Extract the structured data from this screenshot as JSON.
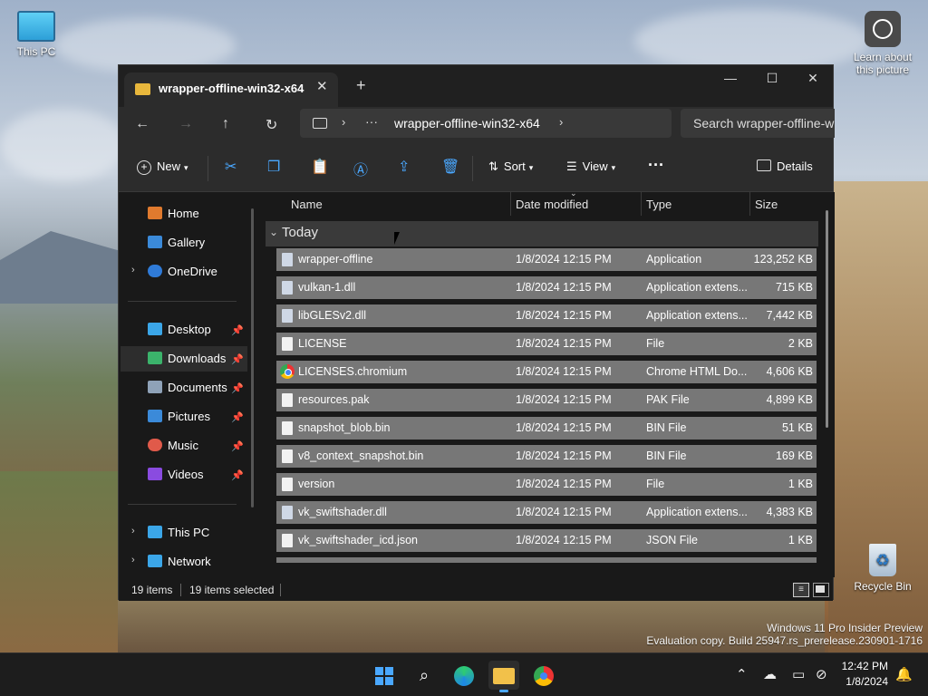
{
  "desktop": {
    "this_pc_label": "This PC",
    "learn_label": "Learn about this picture",
    "recycle_label": "Recycle Bin",
    "watermark_line1": "Windows 11 Pro Insider Preview",
    "watermark_line2": "Evaluation copy. Build 25947.rs_prerelease.230901-1716"
  },
  "window": {
    "tab_title": "wrapper-offline-win32-x64",
    "tab_close": "✕",
    "tab_add": "+",
    "minimize": "—",
    "maximize": "☐",
    "close": "✕",
    "address_ellipsis": "···",
    "address_path": "wrapper-offline-win32-x64",
    "search_placeholder": "Search wrapper-offline-w"
  },
  "toolbar": {
    "new_label": "New",
    "sort_label": "Sort",
    "view_label": "View",
    "more_label": "···",
    "details_label": "Details"
  },
  "sidebar": {
    "items": [
      {
        "label": "Home",
        "icon": "home-icon",
        "color": "#e07a2e"
      },
      {
        "label": "Gallery",
        "icon": "gallery-icon",
        "color": "#3b8ad9"
      },
      {
        "label": "OneDrive",
        "icon": "onedrive-icon",
        "color": "#2f7bd8"
      },
      {
        "label": "Desktop",
        "icon": "desktop-icon",
        "color": "#3ba6e8"
      },
      {
        "label": "Downloads",
        "icon": "downloads-icon",
        "color": "#3bb36b"
      },
      {
        "label": "Documents",
        "icon": "documents-icon",
        "color": "#8fa2b8"
      },
      {
        "label": "Pictures",
        "icon": "pictures-icon",
        "color": "#3b8ad9"
      },
      {
        "label": "Music",
        "icon": "music-icon",
        "color": "#e05a4a"
      },
      {
        "label": "Videos",
        "icon": "videos-icon",
        "color": "#8a4be0"
      },
      {
        "label": "This PC",
        "icon": "this-pc-icon",
        "color": "#3ba6e8"
      },
      {
        "label": "Network",
        "icon": "network-icon",
        "color": "#3ba6e8"
      }
    ]
  },
  "columns": {
    "name": "Name",
    "date": "Date modified",
    "type": "Type",
    "size": "Size"
  },
  "group_label": "Today",
  "files": [
    {
      "name": "wrapper-offline",
      "date": "1/8/2024 12:15 PM",
      "type": "Application",
      "size": "123,252 KB",
      "icon": "app-icon"
    },
    {
      "name": "vulkan-1.dll",
      "date": "1/8/2024 12:15 PM",
      "type": "Application extens...",
      "size": "715 KB",
      "icon": "dll-icon"
    },
    {
      "name": "libGLESv2.dll",
      "date": "1/8/2024 12:15 PM",
      "type": "Application extens...",
      "size": "7,442 KB",
      "icon": "dll-icon"
    },
    {
      "name": "LICENSE",
      "date": "1/8/2024 12:15 PM",
      "type": "File",
      "size": "2 KB",
      "icon": "file-icon"
    },
    {
      "name": "LICENSES.chromium",
      "date": "1/8/2024 12:15 PM",
      "type": "Chrome HTML Do...",
      "size": "4,606 KB",
      "icon": "chrome-icon"
    },
    {
      "name": "resources.pak",
      "date": "1/8/2024 12:15 PM",
      "type": "PAK File",
      "size": "4,899 KB",
      "icon": "file-icon"
    },
    {
      "name": "snapshot_blob.bin",
      "date": "1/8/2024 12:15 PM",
      "type": "BIN File",
      "size": "51 KB",
      "icon": "file-icon"
    },
    {
      "name": "v8_context_snapshot.bin",
      "date": "1/8/2024 12:15 PM",
      "type": "BIN File",
      "size": "169 KB",
      "icon": "file-icon"
    },
    {
      "name": "version",
      "date": "1/8/2024 12:15 PM",
      "type": "File",
      "size": "1 KB",
      "icon": "file-icon"
    },
    {
      "name": "vk_swiftshader.dll",
      "date": "1/8/2024 12:15 PM",
      "type": "Application extens...",
      "size": "4,383 KB",
      "icon": "dll-icon"
    },
    {
      "name": "vk_swiftshader_icd.json",
      "date": "1/8/2024 12:15 PM",
      "type": "JSON File",
      "size": "1 KB",
      "icon": "file-icon"
    }
  ],
  "status": {
    "items_count": "19 items",
    "selected_count": "19 items selected"
  },
  "taskbar": {
    "time": "12:42 PM",
    "date": "1/8/2024"
  },
  "colors": {
    "accent": "#4aa8ff",
    "selection_row": "#777777"
  }
}
